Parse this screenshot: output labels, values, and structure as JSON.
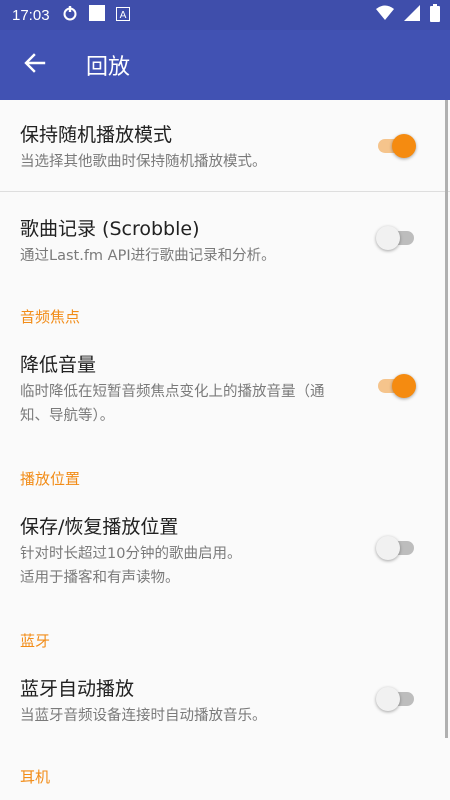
{
  "status_bar": {
    "time": "17:03",
    "icons": [
      "sync-icon",
      "square-icon",
      "a-notification-icon",
      "wifi-icon",
      "signal-icon",
      "battery-icon"
    ]
  },
  "app_bar": {
    "title": "回放",
    "back_icon": "arrow-left-icon"
  },
  "colors": {
    "status_bar": "#3f4eab",
    "app_bar": "#4152b3",
    "accent": "#f58b10",
    "category_text": "#f28c17"
  },
  "prefs": {
    "shuffle": {
      "title": "保持随机播放模式",
      "summary": "当选择其他歌曲时保持随机播放模式。",
      "enabled": true
    },
    "scrobble": {
      "title": "歌曲记录 (Scrobble)",
      "summary": "通过Last.fm API进行歌曲记录和分析。",
      "enabled": false
    },
    "duck": {
      "title": "降低音量",
      "summary": "临时降低在短暂音频焦点变化上的播放音量（通知、导航等）。",
      "enabled": true
    },
    "resume": {
      "title": "保存/恢复播放位置",
      "summary_line1": "针对时长超过10分钟的歌曲启用。",
      "summary_line2": "适用于播客和有声读物。",
      "enabled": false
    },
    "bluetooth_autoplay": {
      "title": "蓝牙自动播放",
      "summary": "当蓝牙音频设备连接时自动播放音乐。",
      "enabled": false
    }
  },
  "categories": {
    "audio_focus": "音频焦点",
    "position": "播放位置",
    "bluetooth": "蓝牙",
    "headset": "耳机"
  }
}
